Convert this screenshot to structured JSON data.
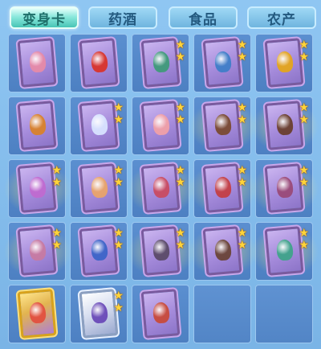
{
  "tabs": [
    {
      "label": "变身卡",
      "active": true
    },
    {
      "label": "药酒",
      "active": false
    },
    {
      "label": "食品",
      "active": false
    },
    {
      "label": "农产",
      "active": false
    }
  ],
  "inventory": {
    "columns": 5,
    "rows": 5,
    "slots": [
      {
        "item": "pink-dragon-card",
        "stars": 0,
        "frame": "purple",
        "figure_color": "#e68aa8"
      },
      {
        "item": "red-fire-dragon-card",
        "stars": 0,
        "frame": "purple",
        "figure_color": "#d9342b"
      },
      {
        "item": "warrior-card",
        "stars": 2,
        "frame": "purple",
        "figure_color": "#3f9a7a"
      },
      {
        "item": "serpent-card",
        "stars": 2,
        "frame": "purple",
        "figure_color": "#3f7ec8"
      },
      {
        "item": "golden-dragon-card",
        "stars": 2,
        "frame": "purple",
        "figure_color": "#e4a51d"
      },
      {
        "item": "monkey-king-card",
        "stars": 0,
        "frame": "purple",
        "figure_color": "#d9822b"
      },
      {
        "item": "unicorn-card",
        "stars": 2,
        "frame": "purple",
        "figure_color": "#d8e3ff"
      },
      {
        "item": "pig-card",
        "stars": 2,
        "frame": "purple",
        "figure_color": "#f0a0a8"
      },
      {
        "item": "bull-demon-card",
        "stars": 2,
        "frame": "purple",
        "figure_color": "#7a4a32",
        "glow": true
      },
      {
        "item": "bull-king-card",
        "stars": 2,
        "frame": "purple",
        "figure_color": "#6a3f2e",
        "glow": true
      },
      {
        "item": "fairy-card",
        "stars": 2,
        "frame": "purple",
        "figure_color": "#c06ad0",
        "glow": true
      },
      {
        "item": "rabbit-card",
        "stars": 2,
        "frame": "purple",
        "figure_color": "#e9a46a"
      },
      {
        "item": "phoenix-card",
        "stars": 2,
        "frame": "purple",
        "figure_color": "#c94b62",
        "glow": true
      },
      {
        "item": "bird-card",
        "stars": 2,
        "frame": "purple",
        "figure_color": "#c43f44",
        "glow": true
      },
      {
        "item": "dancer-card",
        "stars": 2,
        "frame": "purple",
        "figure_color": "#9a4a78",
        "glow": true
      },
      {
        "item": "maiden-card",
        "stars": 2,
        "frame": "purple",
        "figure_color": "#c77aa2",
        "glow": true
      },
      {
        "item": "blue-bear-card",
        "stars": 2,
        "frame": "purple",
        "figure_color": "#3c64c8"
      },
      {
        "item": "armored-demon-card",
        "stars": 2,
        "frame": "purple",
        "figure_color": "#5a4a68",
        "glow": true
      },
      {
        "item": "armored-general-card",
        "stars": 2,
        "frame": "purple",
        "figure_color": "#6a4438",
        "glow": true
      },
      {
        "item": "jade-dragon-card",
        "stars": 2,
        "frame": "purple",
        "figure_color": "#3fa38a",
        "glow": true
      },
      {
        "item": "golden-princess-card",
        "stars": 0,
        "frame": "gold",
        "figure_color": "#e2503f"
      },
      {
        "item": "silver-knight-card",
        "stars": 2,
        "frame": "silver",
        "figure_color": "#6a4ab8"
      },
      {
        "item": "red-warrior-card",
        "stars": 0,
        "frame": "purple",
        "figure_color": "#c84a3a"
      },
      {
        "item": "",
        "stars": 0,
        "frame": "none"
      },
      {
        "item": "",
        "stars": 0,
        "frame": "none"
      }
    ]
  }
}
